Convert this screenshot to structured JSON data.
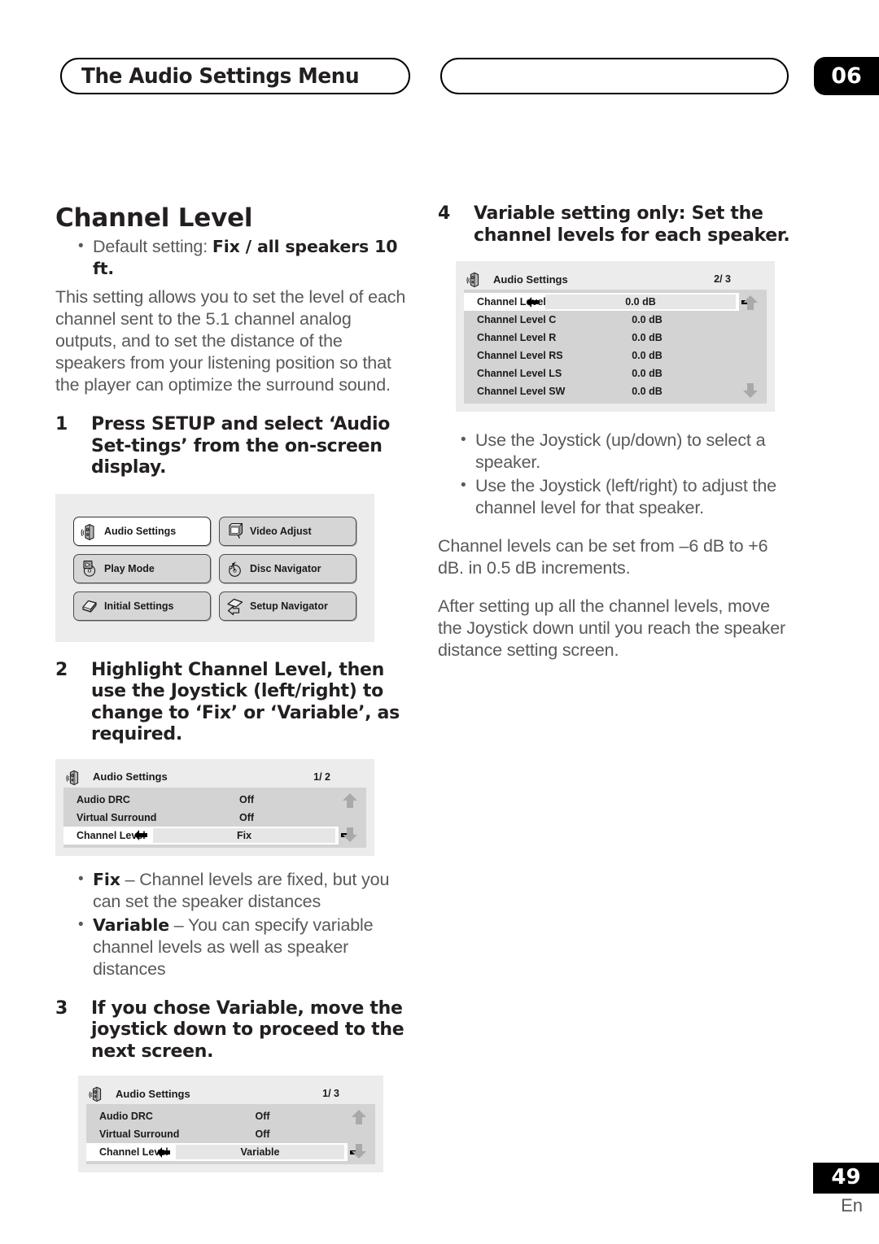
{
  "header": {
    "title": "The Audio Settings Menu",
    "chapter": "06"
  },
  "left_column": {
    "section_title": "Channel Level",
    "default_bullet_prefix": "Default setting: ",
    "default_bullet_bold": "Fix / all speakers 10 ft.",
    "intro_paragraph": "This setting allows you to set the level of each channel sent to the 5.1 channel analog outputs, and to set the distance of the speakers from your listening position so that the player can optimize the surround sound.",
    "step1_num": "1",
    "step1_text": "Press SETUP and select ‘Audio Set-tings’ from the on-screen display.",
    "menu_screen": {
      "buttons": [
        {
          "label": "Audio Settings",
          "icon": "speaker-icon",
          "selected": true
        },
        {
          "label": "Video Adjust",
          "icon": "monitor-icon",
          "selected": false
        },
        {
          "label": "Play Mode",
          "icon": "disc-play-icon",
          "selected": false
        },
        {
          "label": "Disc Navigator",
          "icon": "disc-navigator-icon",
          "selected": false
        },
        {
          "label": "Initial Settings",
          "icon": "disc-slab-icon",
          "selected": false
        },
        {
          "label": "Setup Navigator",
          "icon": "setup-arrow-icon",
          "selected": false
        }
      ]
    },
    "step2_num": "2",
    "step2_text": "Highlight Channel Level, then use the Joystick (left/right) to change to ‘Fix’ or ‘Variable’, as required.",
    "osd_fix": {
      "icon": "speaker-icon",
      "title": "Audio Settings",
      "page": "1/ 2",
      "rows": [
        {
          "name": "Audio DRC",
          "value": "Off",
          "selected": false
        },
        {
          "name": "Virtual Surround",
          "value": "Off",
          "selected": false
        },
        {
          "name": "Channel Level",
          "value": "Fix",
          "selected": true
        }
      ],
      "scroll_up_icon": "scroll-up-arrow-icon",
      "scroll_down_icon": "scroll-down-arrow-icon"
    },
    "bullets_fixvar": [
      {
        "bold": "Fix",
        "rest": " – Channel levels are fixed, but you can set the speaker distances"
      },
      {
        "bold": "Variable",
        "rest": " – You can specify variable channel levels as well as speaker distances"
      }
    ],
    "step3_num": "3",
    "step3_text": "If you chose Variable, move the joystick down to proceed to the next screen.",
    "osd_variable": {
      "icon": "speaker-icon",
      "title": "Audio Settings",
      "page": "1/ 3",
      "rows": [
        {
          "name": "Audio DRC",
          "value": "Off",
          "selected": false
        },
        {
          "name": "Virtual Surround",
          "value": "Off",
          "selected": false
        },
        {
          "name": "Channel Level",
          "value": "Variable",
          "selected": true
        }
      ],
      "scroll_up_icon": "scroll-up-arrow-icon",
      "scroll_down_icon": "scroll-down-arrow-icon"
    }
  },
  "right_column": {
    "step4_num": "4",
    "step4_text": "Variable setting only: Set the channel levels for each speaker.",
    "osd_levels": {
      "icon": "speaker-icon",
      "title": "Audio Settings",
      "page": "2/ 3",
      "rows": [
        {
          "name": "Channel Level L",
          "value": "0.0 dB",
          "selected": true
        },
        {
          "name": "Channel Level C",
          "value": "0.0 dB",
          "selected": false
        },
        {
          "name": "Channel Level R",
          "value": "0.0 dB",
          "selected": false
        },
        {
          "name": "Channel Level RS",
          "value": "0.0 dB",
          "selected": false
        },
        {
          "name": "Channel Level LS",
          "value": "0.0 dB",
          "selected": false
        },
        {
          "name": "Channel Level SW",
          "value": "0.0 dB",
          "selected": false
        }
      ],
      "scroll_up_icon": "scroll-up-arrow-icon",
      "scroll_down_icon": "scroll-down-arrow-icon"
    },
    "bullets_joystick": [
      "Use the Joystick (up/down) to select a speaker.",
      "Use the Joystick (left/right) to adjust the channel level for that speaker."
    ],
    "paragraph_range": "Channel levels can be set from –6 dB to +6 dB. in 0.5 dB increments.",
    "paragraph_after": "After setting up all the channel levels, move the Joystick down until you reach the speaker distance setting screen."
  },
  "footer": {
    "page_number": "49",
    "language": "En"
  }
}
